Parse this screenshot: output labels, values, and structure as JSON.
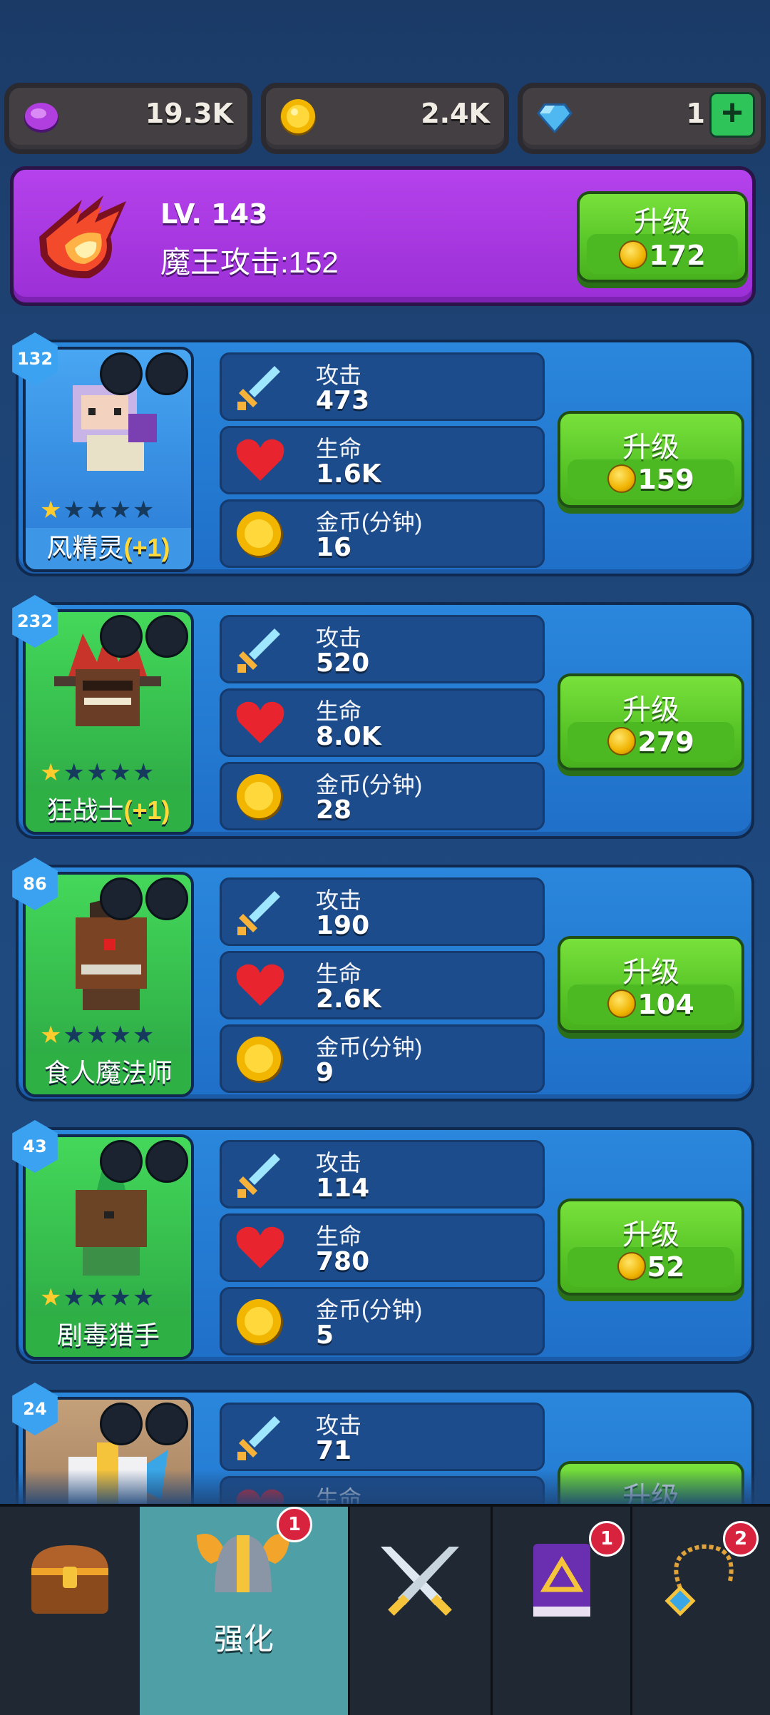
{
  "currency": {
    "gems_purple": "19.3K",
    "coins": "2.4K",
    "diamonds": "1"
  },
  "boss": {
    "level": "LV. 143",
    "attack": "魔王攻击:152",
    "upgrade_label": "升级",
    "upgrade_cost": "172"
  },
  "labels": {
    "attack": "攻击",
    "hp": "生命",
    "gold": "金币(分钟)",
    "upgrade": "升级"
  },
  "heroes": [
    {
      "level": "132",
      "name": "风精灵",
      "bonus": "(+1)",
      "stars": 1,
      "attack": "473",
      "hp": "1.6K",
      "gold": "16",
      "cost": "159",
      "bg": "#2f86e0"
    },
    {
      "level": "232",
      "name": "狂战士",
      "bonus": "(+1)",
      "stars": 1,
      "attack": "520",
      "hp": "8.0K",
      "gold": "28",
      "cost": "279",
      "bg": "#36b44a"
    },
    {
      "level": "86",
      "name": "食人魔法师",
      "bonus": "",
      "stars": 1,
      "attack": "190",
      "hp": "2.6K",
      "gold": "9",
      "cost": "104",
      "bg": "#36b44a"
    },
    {
      "level": "43",
      "name": "剧毒猎手",
      "bonus": "",
      "stars": 1,
      "attack": "114",
      "hp": "780",
      "gold": "5",
      "cost": "52",
      "bg": "#36b44a"
    },
    {
      "level": "24",
      "name": "",
      "bonus": "",
      "stars": 0,
      "attack": "71",
      "hp": "",
      "gold": "",
      "cost": "",
      "bg": "#a07a55"
    }
  ],
  "nav": {
    "items": [
      "chest",
      "upgrade",
      "battle",
      "spellbook",
      "amulet"
    ],
    "active_label": "强化",
    "badge_upgrade": "1",
    "badge_spellbook": "1",
    "badge_amulet": "2"
  },
  "colors": {
    "panel": "#2379d4",
    "button_green": "#5ac729",
    "boss_purple": "#a936e0",
    "nav_active": "#4f9fa6"
  }
}
